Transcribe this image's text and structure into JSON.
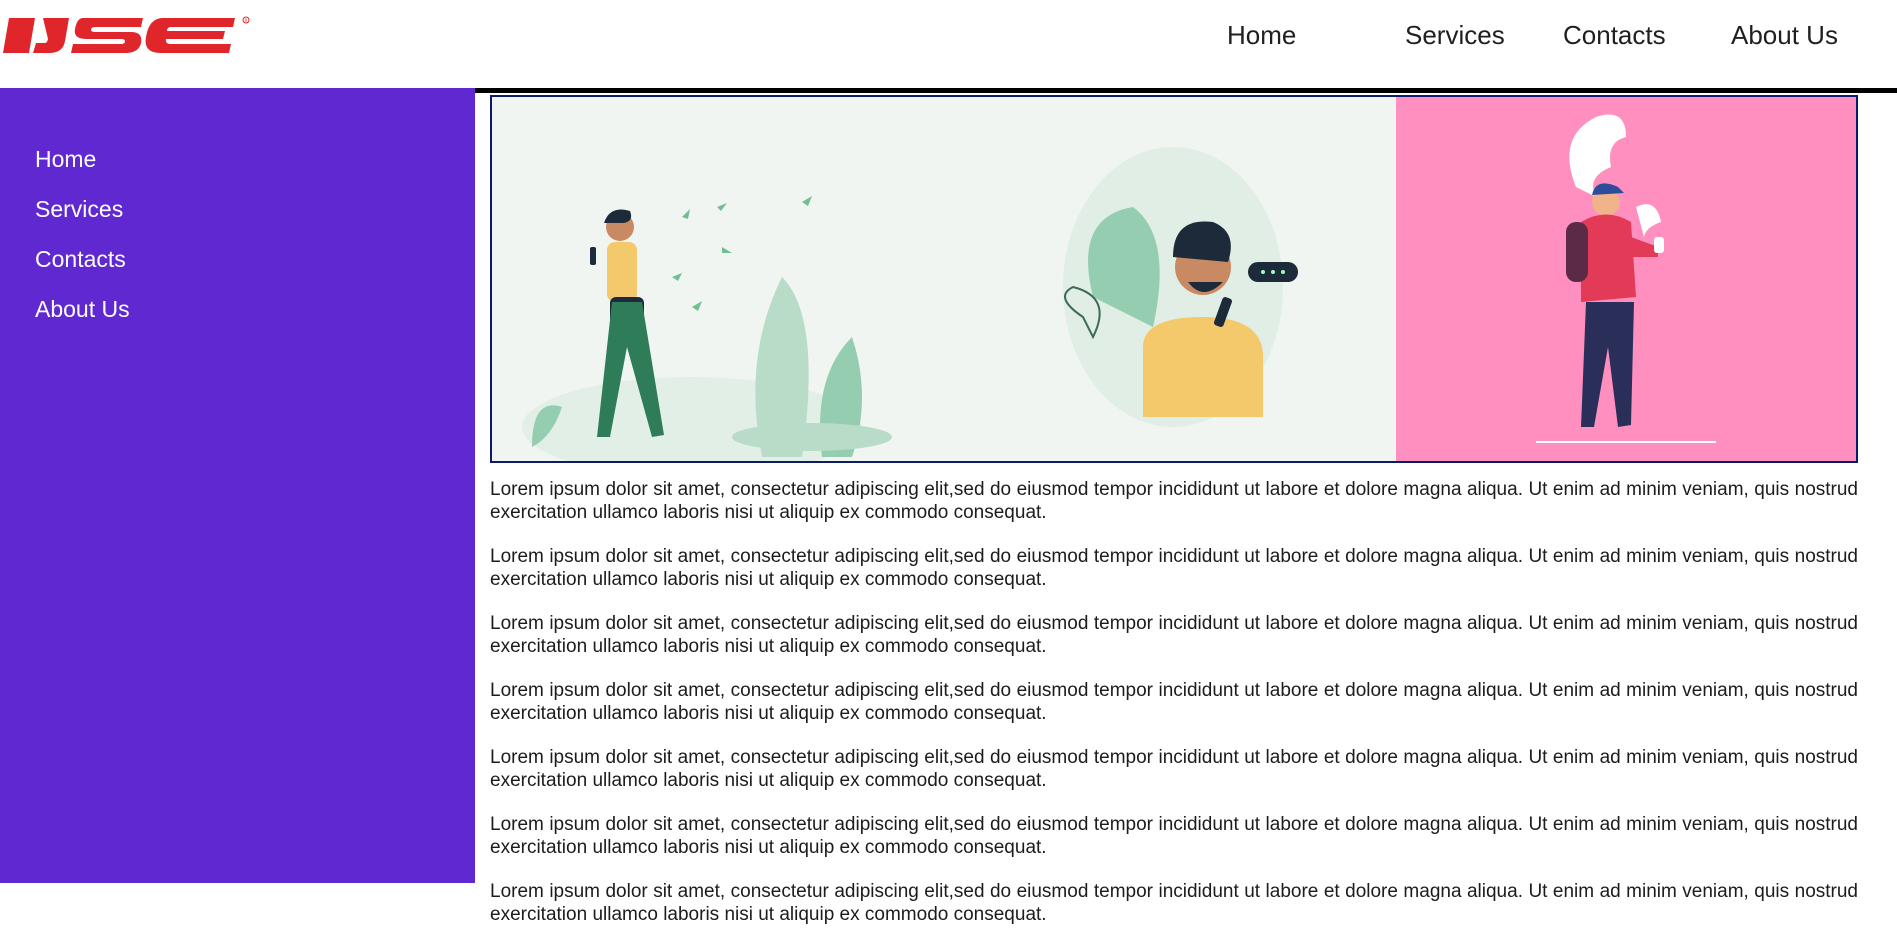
{
  "header": {
    "logo_text": "IJSE",
    "nav": [
      "Home",
      "Services",
      "Contacts",
      "About Us"
    ]
  },
  "sidebar": {
    "items": [
      "Home",
      "Services",
      "Contacts",
      "About Us"
    ]
  },
  "gallery": {
    "images": [
      "man-walking-phone-illustration",
      "man-texting-illustration",
      "man-smoking-pink-illustration"
    ]
  },
  "content": {
    "paragraphs": [
      "Lorem ipsum dolor sit amet, consectetur adipiscing elit,sed do eiusmod tempor incididunt ut labore et dolore magna aliqua. Ut enim ad minim veniam, quis nostrud exercitation ullamco laboris nisi ut aliquip ex commodo consequat.",
      "Lorem ipsum dolor sit amet, consectetur adipiscing elit,sed do eiusmod tempor incididunt ut labore et dolore magna aliqua. Ut enim ad minim veniam, quis nostrud exercitation ullamco laboris nisi ut aliquip ex commodo consequat.",
      "Lorem ipsum dolor sit amet, consectetur adipiscing elit,sed do eiusmod tempor incididunt ut labore et dolore magna aliqua. Ut enim ad minim veniam, quis nostrud exercitation ullamco laboris nisi ut aliquip ex commodo consequat.",
      "Lorem ipsum dolor sit amet, consectetur adipiscing elit,sed do eiusmod tempor incididunt ut labore et dolore magna aliqua. Ut enim ad minim veniam, quis nostrud exercitation ullamco laboris nisi ut aliquip ex commodo consequat.",
      "Lorem ipsum dolor sit amet, consectetur adipiscing elit,sed do eiusmod tempor incididunt ut labore et dolore magna aliqua. Ut enim ad minim veniam, quis nostrud exercitation ullamco laboris nisi ut aliquip ex commodo consequat.",
      "Lorem ipsum dolor sit amet, consectetur adipiscing elit,sed do eiusmod tempor incididunt ut labore et dolore magna aliqua. Ut enim ad minim veniam, quis nostrud exercitation ullamco laboris nisi ut aliquip ex commodo consequat.",
      "Lorem ipsum dolor sit amet, consectetur adipiscing elit,sed do eiusmod tempor incididunt ut labore et dolore magna aliqua. Ut enim ad minim veniam, quis nostrud exercitation ullamco laboris nisi ut aliquip ex commodo consequat."
    ]
  },
  "colors": {
    "sidebar_bg": "#6028d1",
    "logo_red": "#e0262b",
    "gallery_border": "#0b1a6b",
    "tile_light_bg": "#f0f5f1",
    "tile_pink_bg": "#ff8fbf"
  }
}
